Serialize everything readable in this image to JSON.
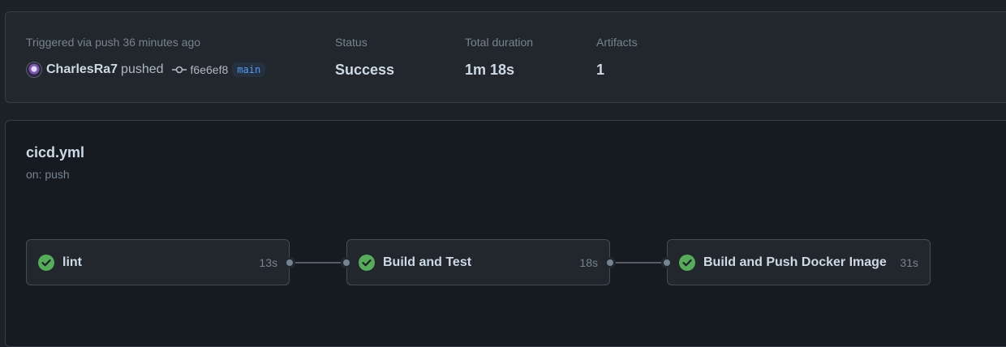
{
  "summary": {
    "trigger_label": "Triggered via push 36 minutes ago",
    "actor": "CharlesRa7",
    "action": "pushed",
    "commit_sha": "f6e6ef8",
    "branch": "main",
    "status_label": "Status",
    "status_value": "Success",
    "duration_label": "Total duration",
    "duration_value": "1m 18s",
    "artifacts_label": "Artifacts",
    "artifacts_value": "1"
  },
  "workflow": {
    "file": "cicd.yml",
    "trigger": "on: push",
    "jobs": [
      {
        "name": "lint",
        "duration": "13s",
        "status": "success",
        "icon": "check-circle-icon"
      },
      {
        "name": "Build and Test",
        "duration": "18s",
        "status": "success",
        "icon": "check-circle-icon"
      },
      {
        "name": "Build and Push Docker Image",
        "duration": "31s",
        "status": "success",
        "icon": "check-circle-icon"
      }
    ]
  },
  "colors": {
    "success": "#57ab5a",
    "link": "#539bf5",
    "background": "#1c2128",
    "card": "#22272e"
  }
}
